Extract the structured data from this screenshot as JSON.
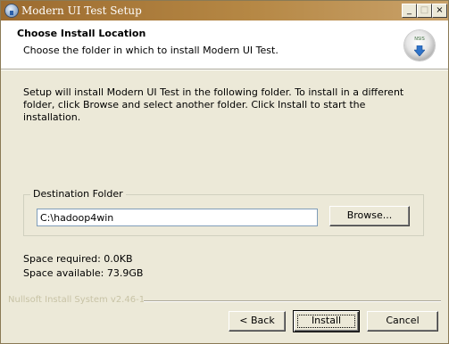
{
  "window": {
    "title": "Modern UI Test Setup",
    "buttons": {
      "minimize": "_",
      "maximize": "□",
      "close": "×"
    }
  },
  "header": {
    "title": "Choose Install Location",
    "subtitle": "Choose the folder in which to install Modern UI Test.",
    "logo_label": "NSIS"
  },
  "body": {
    "intro": "Setup will install Modern UI Test in the following folder. To install in a different folder, click Browse and select another folder. Click Install to start the installation."
  },
  "destination": {
    "legend": "Destination Folder",
    "path": "C:\\hadoop4win",
    "browse_label": "Browse..."
  },
  "space": {
    "required": "Space required: 0.0KB",
    "available": "Space available: 73.9GB"
  },
  "footer": {
    "brand": "Nullsoft Install System v2.46-1",
    "back_label": "< Back",
    "install_label": "Install",
    "cancel_label": "Cancel"
  }
}
